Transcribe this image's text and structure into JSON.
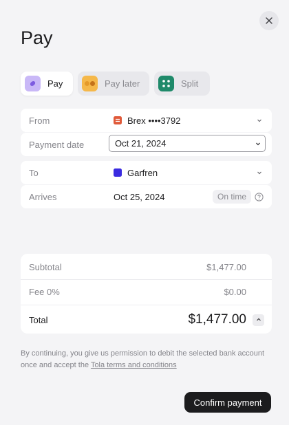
{
  "header": {
    "title": "Pay"
  },
  "tabs": [
    {
      "label": "Pay",
      "icon": "pay-icon",
      "active": true
    },
    {
      "label": "Pay later",
      "icon": "pay-later-icon",
      "active": false
    },
    {
      "label": "Split",
      "icon": "split-icon",
      "active": false
    }
  ],
  "form": {
    "from": {
      "label": "From",
      "value": "Brex ••••3792",
      "icon": "bank-icon"
    },
    "payment_date": {
      "label": "Payment date",
      "value": "Oct 21, 2024"
    },
    "to": {
      "label": "To",
      "value": "Garfren",
      "icon": "recipient-icon"
    },
    "arrives": {
      "label": "Arrives",
      "value": "Oct 25, 2024",
      "badge": "On time"
    }
  },
  "summary": {
    "subtotal_label": "Subtotal",
    "subtotal_value": "$1,477.00",
    "fee_label": "Fee 0%",
    "fee_value": "$0.00",
    "total_label": "Total",
    "total_value": "$1,477.00"
  },
  "disclaimer": {
    "text": "By continuing, you give us permission to debit the selected bank account once and accept the",
    "link": "Tola terms and conditions"
  },
  "actions": {
    "confirm_label": "Confirm payment"
  },
  "colors": {
    "accent_pay": "#a58cf0",
    "accent_pay_later": "#f5b84a",
    "accent_split": "#1f8a6a",
    "bank_icon": "#e05a3a",
    "recipient_icon": "#3a2be0",
    "button_dark": "#1c1c1e"
  }
}
